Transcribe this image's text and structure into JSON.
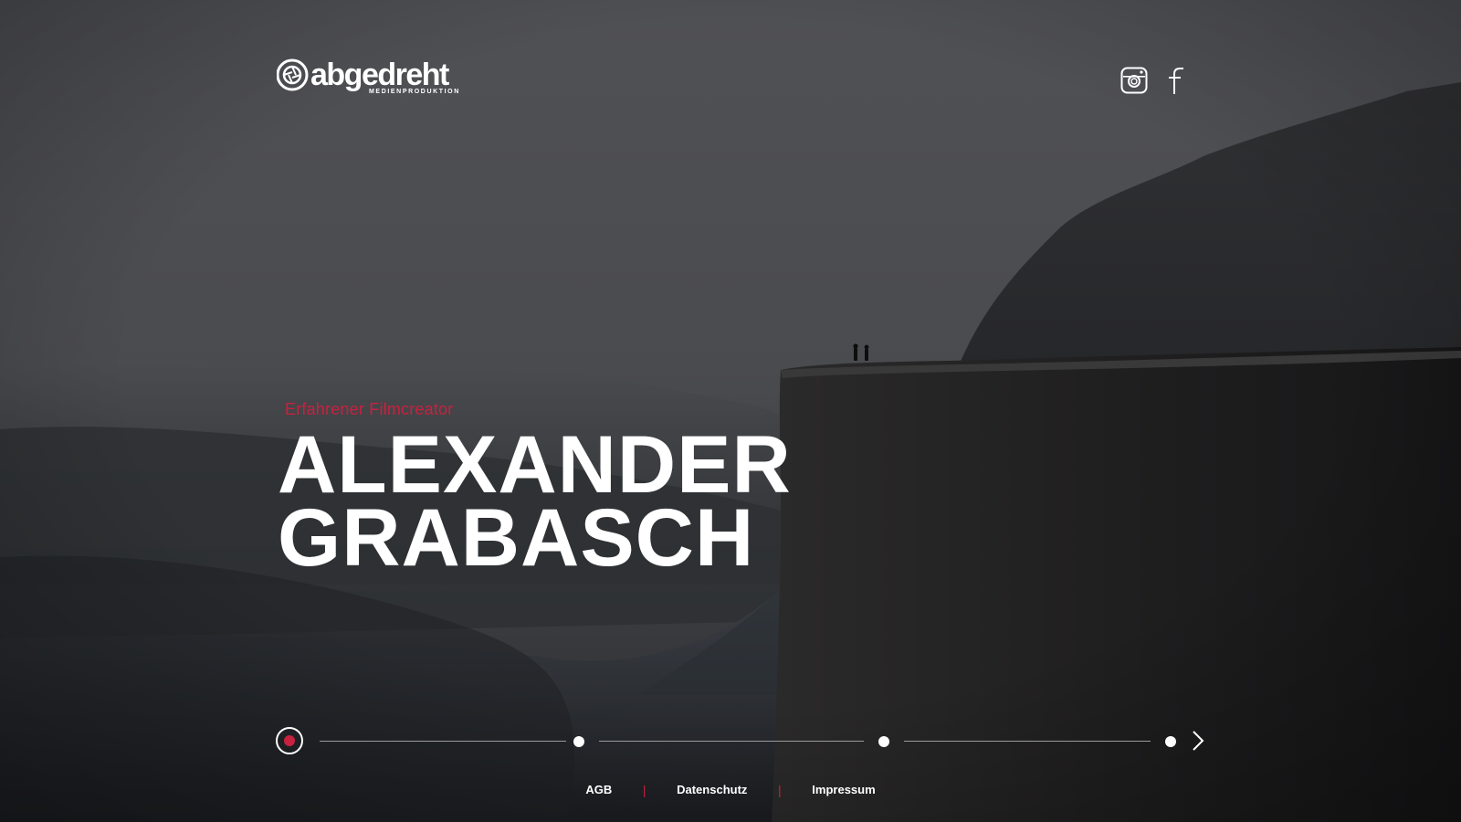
{
  "brand": {
    "name": "abgedreht",
    "tagline": "MEDIENPRODUKTION"
  },
  "social": [
    {
      "icon": "instagram-icon"
    },
    {
      "icon": "facebook-icon"
    }
  ],
  "hero": {
    "eyebrow": "Erfahrener Filmcreator",
    "headline_line1": "ALEXANDER",
    "headline_line2": "GRABASCH"
  },
  "slider": {
    "slide_count": 4,
    "active_slide": 1,
    "next_icon": "chevron-right-icon"
  },
  "footer": {
    "links": [
      "AGB",
      "Datenschutz",
      "Impressum"
    ],
    "separator": "|"
  },
  "colors": {
    "accent": "#c8213f",
    "text": "#ffffff",
    "background": "#2b2c2f"
  }
}
